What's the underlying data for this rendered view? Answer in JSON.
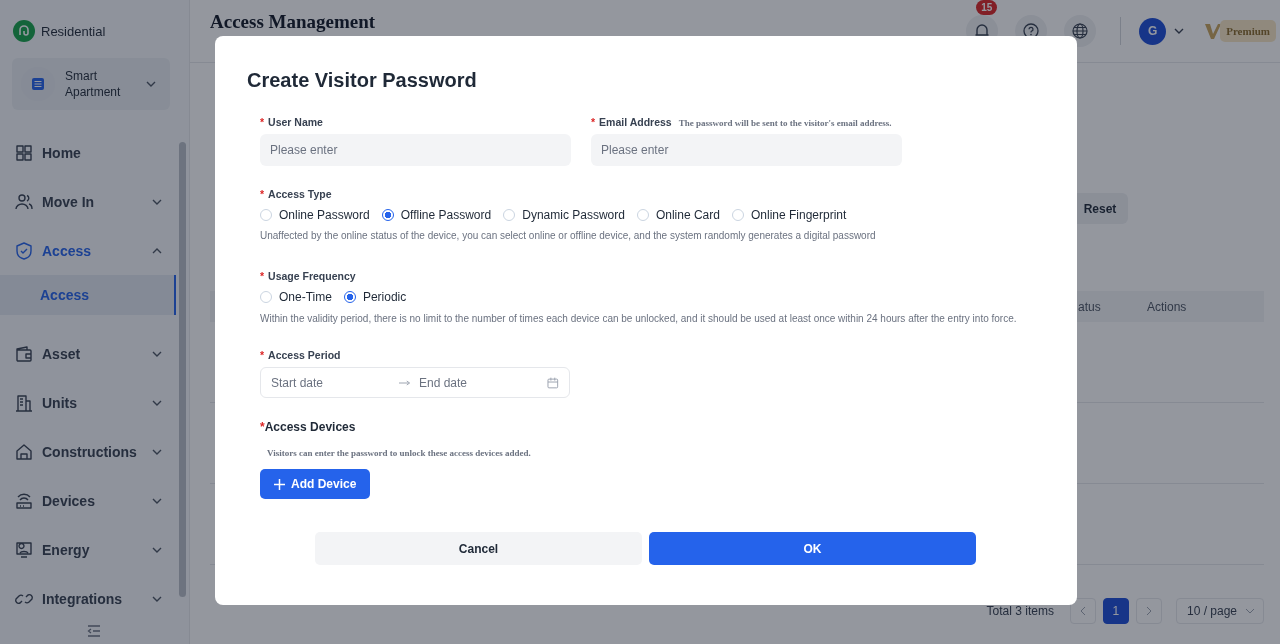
{
  "sidebar": {
    "brand": "Residential",
    "project": "Smart Apartment",
    "items": [
      {
        "label": "Home",
        "kind": "link",
        "selected": false
      },
      {
        "label": "Move In",
        "kind": "menu",
        "selected": false,
        "expanded": false
      },
      {
        "label": "Access",
        "kind": "menu",
        "selected": true,
        "expanded": true,
        "children": [
          {
            "label": "Access",
            "selected": true
          }
        ]
      },
      {
        "label": "Asset",
        "kind": "menu",
        "selected": false,
        "expanded": false
      },
      {
        "label": "Units",
        "kind": "menu",
        "selected": false,
        "expanded": false
      },
      {
        "label": "Constructions",
        "kind": "menu",
        "selected": false,
        "expanded": false
      },
      {
        "label": "Devices",
        "kind": "menu",
        "selected": false,
        "expanded": false
      },
      {
        "label": "Energy",
        "kind": "menu",
        "selected": false,
        "expanded": false
      },
      {
        "label": "Integrations",
        "kind": "menu",
        "selected": false,
        "expanded": false
      }
    ]
  },
  "header": {
    "title": "Access Management",
    "notifications": "15",
    "avatar": "G",
    "plan": "Premium"
  },
  "background": {
    "reset_button": "Reset",
    "columns": [
      "atus",
      "Actions"
    ],
    "total": "Total 3 items",
    "pages": [
      {
        "label": "1",
        "selected": true
      }
    ],
    "page_size": "10 / page"
  },
  "dialog": {
    "title": "Create Visitor Password",
    "user_name": {
      "label": "User Name",
      "marker": "*",
      "placeholder": "Please enter"
    },
    "email": {
      "label": "Email Address",
      "marker": "*",
      "hint": "The password will be sent to the visitor's email address.",
      "placeholder": "Please enter"
    },
    "access_type": {
      "label": "Access Type",
      "marker": "*",
      "options": [
        {
          "label": "Online Password",
          "selected": false
        },
        {
          "label": "Offline Password",
          "selected": true
        },
        {
          "label": "Dynamic Password",
          "selected": false
        },
        {
          "label": "Online Card",
          "selected": false
        },
        {
          "label": "Online Fingerprint",
          "selected": false
        }
      ],
      "help": "Unaffected by the online status of the device, you can select online or offline device, and the system randomly generates a digital password"
    },
    "usage_frequency": {
      "label": "Usage Frequency",
      "marker": "*",
      "options": [
        {
          "label": "One-Time",
          "selected": false
        },
        {
          "label": "Periodic",
          "selected": true
        }
      ],
      "help": "Within the validity period, there is no limit to the number of times each device can be unlocked, and it should be used at least once within 24 hours after the entry into force."
    },
    "access_period": {
      "label": "Access Period",
      "marker": "*",
      "start_placeholder": "Start date",
      "end_placeholder": "End date"
    },
    "access_devices": {
      "label": "Access Devices",
      "marker": "*",
      "hint": "Visitors can enter the password to unlock these access devices added.",
      "button": "Add Device"
    },
    "buttons": {
      "cancel": "Cancel",
      "ok": "OK"
    }
  }
}
